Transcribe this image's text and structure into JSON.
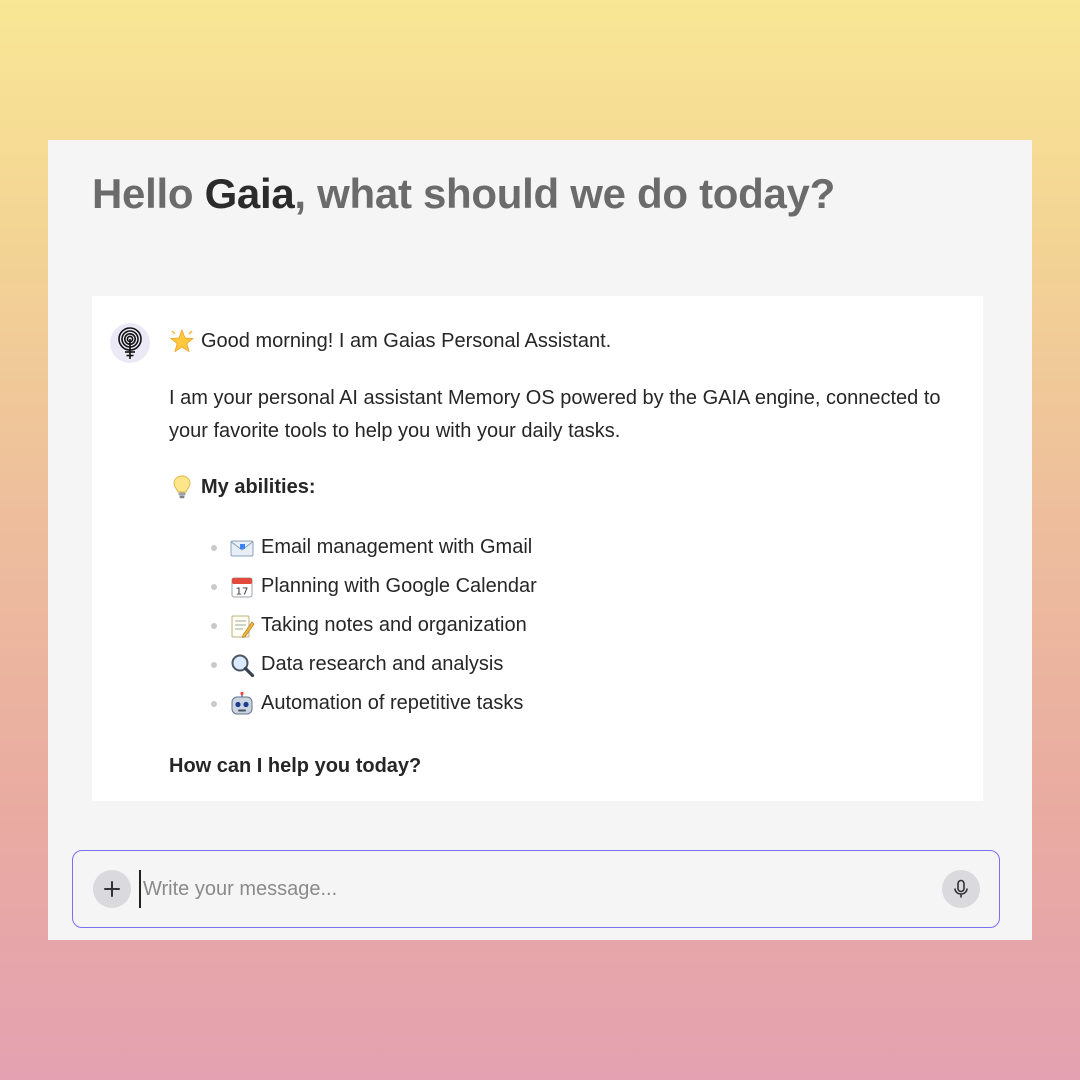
{
  "header": {
    "greeting_prefix": "Hello ",
    "user_name": "Gaia",
    "greeting_suffix": ", what should we do today?"
  },
  "assistant_message": {
    "greeting_emoji": "glowing-star",
    "greeting": "Good morning! I am Gaias Personal Assistant.",
    "intro": "I am your personal AI assistant Memory OS powered by the GAIA engine, connected to your favorite tools to help you with your daily tasks.",
    "abilities_emoji": "light-bulb",
    "abilities_title": "My abilities:",
    "abilities": [
      {
        "icon": "envelope-icon",
        "label": "Email management with Gmail"
      },
      {
        "icon": "calendar-icon",
        "label": "Planning with Google Calendar"
      },
      {
        "icon": "memo-icon",
        "label": "Taking notes and organization"
      },
      {
        "icon": "magnifier-icon",
        "label": "Data research and analysis"
      },
      {
        "icon": "robot-icon",
        "label": "Automation of repetitive tasks"
      }
    ],
    "closing": "How can I help you today?"
  },
  "composer": {
    "placeholder": "Write your message...",
    "value": "",
    "add_icon": "plus-icon",
    "mic_icon": "microphone-icon"
  },
  "colors": {
    "accent_border": "#7b6ff0",
    "card_bg": "#f5f5f5",
    "message_bg": "#ffffff",
    "greeting_text": "#6b6b6b",
    "name_text": "#2b2b2b"
  }
}
